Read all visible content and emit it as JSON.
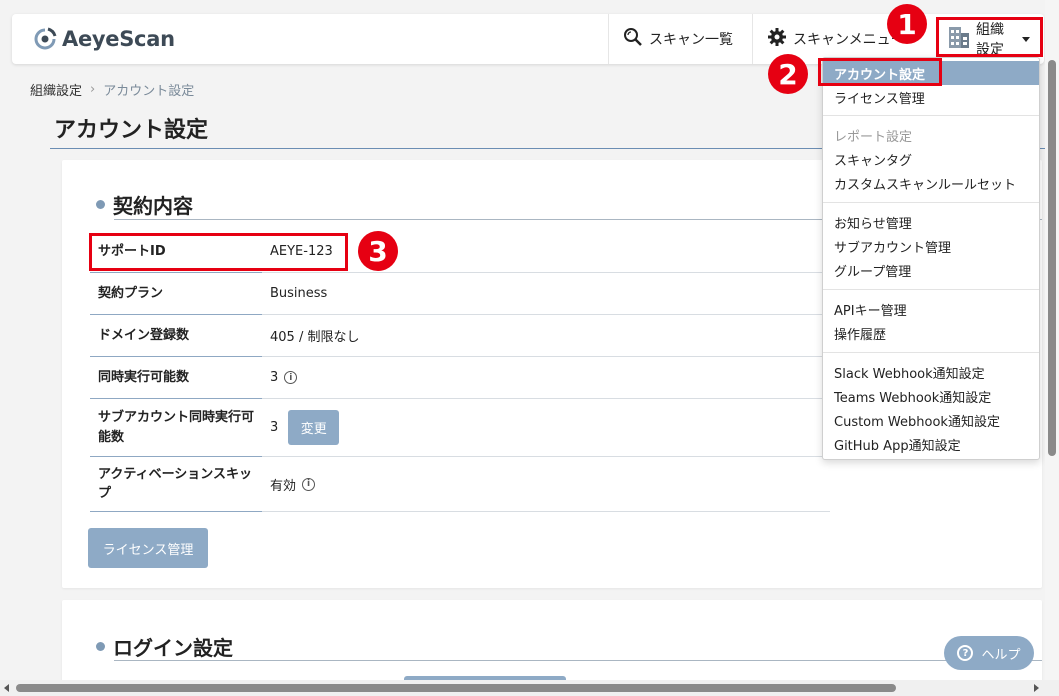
{
  "header": {
    "logo_text": "AeyeScan",
    "nav": {
      "scan_list": "スキャン一覧",
      "scan_menu": "スキャンメニュー",
      "org_settings": "組織設定"
    }
  },
  "breadcrumb": {
    "parent": "組織設定",
    "current": "アカウント設定"
  },
  "page_title": "アカウント設定",
  "contract": {
    "heading": "契約内容",
    "rows": [
      {
        "label": "サポートID",
        "value": "AEYE-123"
      },
      {
        "label": "契約プラン",
        "value": "Business"
      },
      {
        "label": "ドメイン登録数",
        "value": "405 / 制限なし"
      },
      {
        "label": "同時実行可能数",
        "value": "3"
      },
      {
        "label": "サブアカウント同時実行可能数",
        "value": "3"
      },
      {
        "label": "アクティベーションスキップ",
        "value": "有効"
      }
    ],
    "change_button": "変更",
    "license_button": "ライセンス管理"
  },
  "login": {
    "heading": "ログイン設定"
  },
  "dropdown": {
    "items_group1": [
      "アカウント設定",
      "ライセンス管理"
    ],
    "group2_header": "レポート設定",
    "items_group2": [
      "スキャンタグ",
      "カスタムスキャンルールセット"
    ],
    "items_group3": [
      "お知らせ管理",
      "サブアカウント管理",
      "グループ管理"
    ],
    "items_group4": [
      "APIキー管理",
      "操作履歴"
    ],
    "items_group5": [
      "Slack Webhook通知設定",
      "Teams Webhook通知設定",
      "Custom Webhook通知設定",
      "GitHub App通知設定"
    ]
  },
  "callouts": [
    "1",
    "2",
    "3"
  ],
  "help": {
    "label": "ヘルプ"
  },
  "colors": {
    "accent": "#8eaac6",
    "callout": "#e60012",
    "title_line": "#6b8db3"
  }
}
